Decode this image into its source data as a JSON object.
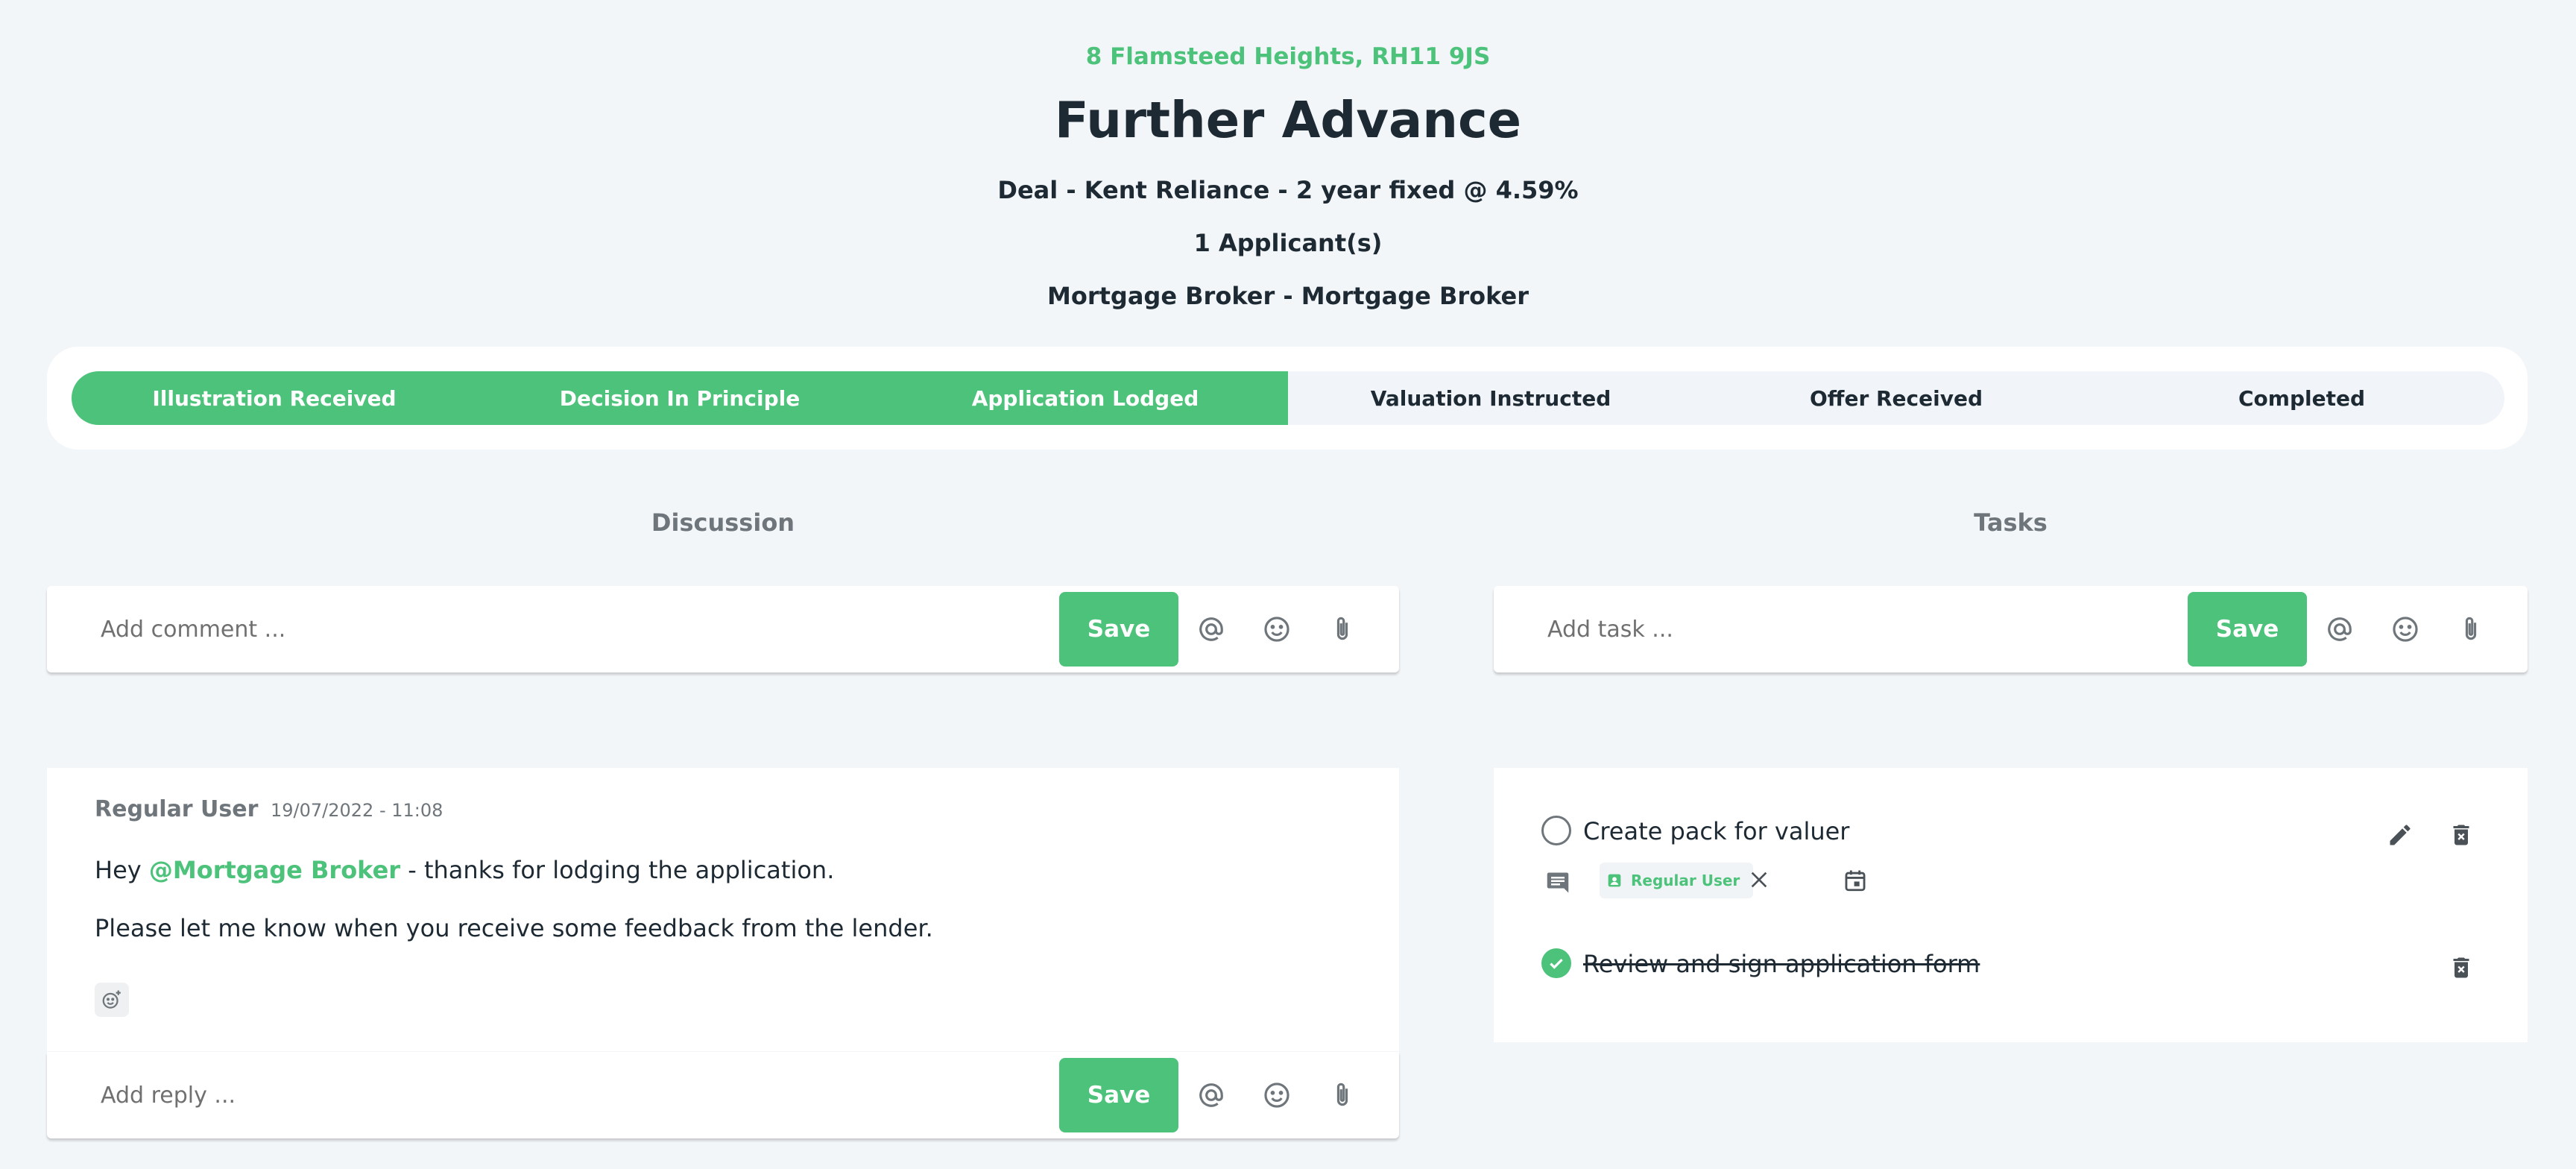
{
  "header": {
    "address": "8 Flamsteed Heights, RH11 9JS",
    "title": "Further Advance",
    "deal": "Deal - Kent Reliance - 2 year fixed @ 4.59%",
    "applicants": "1 Applicant(s)",
    "broker": "Mortgage Broker - Mortgage Broker"
  },
  "progress": {
    "steps": [
      {
        "label": "Illustration Received",
        "done": true
      },
      {
        "label": "Decision In Principle",
        "done": true
      },
      {
        "label": "Application Lodged",
        "done": true
      },
      {
        "label": "Valuation Instructed",
        "done": false
      },
      {
        "label": "Offer Received",
        "done": false
      },
      {
        "label": "Completed",
        "done": false
      }
    ]
  },
  "discussion": {
    "heading": "Discussion",
    "comment_placeholder": "Add comment ...",
    "save_label": "Save",
    "comments": [
      {
        "author": "Regular User",
        "timestamp": "19/07/2022 - 11:08",
        "line1_prefix": "Hey ",
        "mention": "@Mortgage Broker",
        "line1_suffix": " - thanks for lodging the application.",
        "line2": "Please let me know when you receive some feedback from the lender."
      }
    ],
    "reply_placeholder": "Add reply ...",
    "reply_save_label": "Save"
  },
  "tasks": {
    "heading": "Tasks",
    "task_placeholder": "Add task ...",
    "save_label": "Save",
    "items": [
      {
        "label": "Create pack for valuer",
        "completed": false,
        "assignee": "Regular User"
      },
      {
        "label": "Review and sign application form",
        "completed": true
      }
    ]
  },
  "colors": {
    "accent": "#4cc27a",
    "background": "#f3f6f9",
    "text": "#1e2a33",
    "muted": "#6f767b"
  },
  "icons": [
    "at-sign-icon",
    "emoji-icon",
    "paperclip-icon",
    "add-reaction-icon",
    "comment-icon",
    "user-badge-icon",
    "close-icon",
    "calendar-icon",
    "edit-icon",
    "delete-icon",
    "check-icon"
  ]
}
